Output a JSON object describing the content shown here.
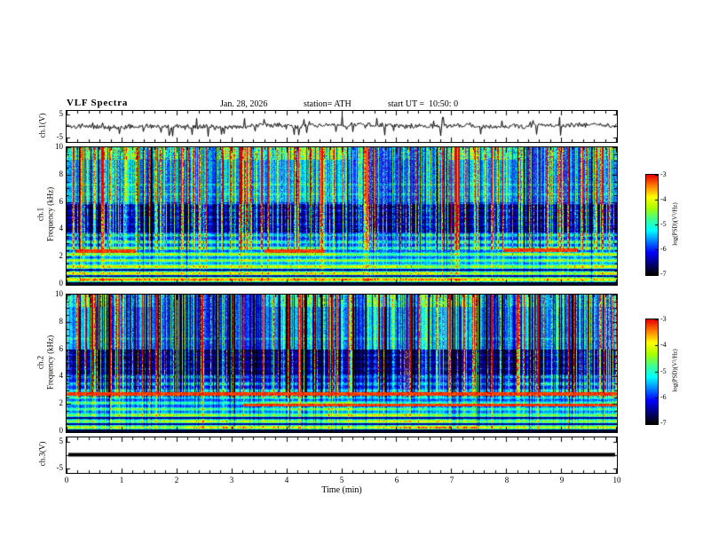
{
  "header": {
    "title": "VLF Spectra",
    "date": "Jan. 28, 2026",
    "station": "station= ATH",
    "start_ut": "start UT =  10:50: 0"
  },
  "xaxis": {
    "label": "Time (min)",
    "min": 0,
    "max": 10,
    "major_ticks": [
      0,
      1,
      2,
      3,
      4,
      5,
      6,
      7,
      8,
      9,
      10
    ],
    "minor_tick_step": 0.2
  },
  "colorbar": {
    "label": "log(PSD)(V²/Hz)",
    "ticks": [
      -3,
      -4,
      -5,
      -6,
      -7
    ],
    "max": -3,
    "min": -7,
    "stops": [
      "#000000",
      "#00007f",
      "#0000ff",
      "#0080ff",
      "#00ffff",
      "#40ff90",
      "#a8ff00",
      "#ffff00",
      "#ff8000",
      "#e60000"
    ]
  },
  "chart_data": [
    {
      "type": "line",
      "name": "ch1-waveform",
      "ylabel": "ch.1(V)",
      "yticks": [
        5,
        -5
      ],
      "ylim": [
        -6.5,
        6.5
      ],
      "description": "broadband noisy voltage trace with many impulsive sferic spikes",
      "seed": 11,
      "noise_amp": 0.9,
      "spike_rate": 0.1,
      "spike_amp": 3.8
    },
    {
      "type": "heatmap",
      "name": "ch1-spectrogram",
      "ylabel_channel": "ch.1",
      "ylabel_axis": "Frequency (kHz)",
      "ylim": [
        0,
        10
      ],
      "yticks": [
        0,
        2,
        4,
        6,
        8,
        10
      ],
      "value_scale": "log PSD from -7 to -3 (V²/Hz)",
      "seed": 7,
      "gen": {
        "pos_bias": 0.85,
        "sferic_rate": 0.05,
        "high_band_boost": 0.2,
        "mid_dip": [
          3.8,
          5.9,
          0.12
        ],
        "black_floor_khz": 0.18,
        "bands": [
          {
            "f": 0.35,
            "w": 0.1,
            "a": 0.5
          },
          {
            "f": 0.8,
            "w": 0.09,
            "a": 0.42
          },
          {
            "f": 1.3,
            "w": 0.1,
            "a": 0.45
          },
          {
            "f": 1.75,
            "w": 0.08,
            "a": 0.4
          },
          {
            "f": 2.2,
            "w": 0.09,
            "a": 0.45
          },
          {
            "f": 2.65,
            "w": 0.08,
            "a": 0.35
          },
          {
            "f": 3.1,
            "w": 0.09,
            "a": 0.3
          },
          {
            "f": 3.6,
            "w": 0.08,
            "a": 0.22
          }
        ],
        "faint_lines": [
          4.4,
          4.9,
          5.4,
          5.9,
          6.6,
          7.3
        ],
        "dark_lines": [
          0.12,
          0.6,
          1.05
        ],
        "red_segments": [
          {
            "f": 2.45,
            "t0": 0.15,
            "t1": 1.25
          },
          {
            "f": 2.45,
            "t0": 3.6,
            "t1": 4.7
          },
          {
            "f": 2.5,
            "t0": 7.95,
            "t1": 9.3
          }
        ]
      }
    },
    {
      "type": "heatmap",
      "name": "ch2-spectrogram",
      "ylabel_channel": "ch.2",
      "ylabel_axis": "Frequency (kHz)",
      "ylim": [
        0,
        10
      ],
      "yticks": [
        0,
        2,
        4,
        6,
        8,
        10
      ],
      "value_scale": "log PSD from -7 to -3 (V²/Hz)",
      "seed": 13,
      "gen": {
        "pos_bias": 0.55,
        "sferic_rate": 0.06,
        "high_band_boost": 0.26,
        "mid_dip": [
          4.2,
          6.2,
          0.08
        ],
        "black_floor_khz": 0.18,
        "bands": [
          {
            "f": 0.3,
            "w": 0.1,
            "a": 0.5
          },
          {
            "f": 0.75,
            "w": 0.09,
            "a": 0.45
          },
          {
            "f": 1.2,
            "w": 0.1,
            "a": 0.48
          },
          {
            "f": 1.65,
            "w": 0.08,
            "a": 0.42
          },
          {
            "f": 2.1,
            "w": 0.09,
            "a": 0.4
          },
          {
            "f": 2.5,
            "w": 0.08,
            "a": 0.35
          },
          {
            "f": 3.0,
            "w": 0.09,
            "a": 0.32
          },
          {
            "f": 3.5,
            "w": 0.09,
            "a": 0.28
          },
          {
            "f": 4.0,
            "w": 0.09,
            "a": 0.22
          }
        ],
        "faint_lines": [
          4.6,
          5.1,
          5.6,
          6.1,
          6.8
        ],
        "dark_lines": [
          0.12,
          0.55,
          1.0
        ],
        "red_segments": [
          {
            "f": 2.75,
            "t0": 0,
            "t1": 10
          },
          {
            "f": 1.95,
            "t0": 3.2,
            "t1": 10
          }
        ]
      }
    },
    {
      "type": "line",
      "name": "ch3-waveform",
      "ylabel": "ch.3(V)",
      "yticks": [
        5,
        -5
      ],
      "ylim": [
        -6.5,
        6.5
      ],
      "description": "flat thick line at 0 V (channel inactive)",
      "flat_value": 0
    }
  ]
}
